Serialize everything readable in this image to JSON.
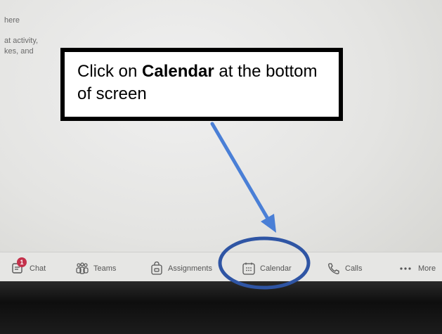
{
  "background_text": [
    "here",
    "at activity,",
    "kes, and"
  ],
  "callout": {
    "prefix": "Click on ",
    "bold": "Calendar",
    "suffix": " at the bottom of screen"
  },
  "taskbar": {
    "items": [
      {
        "label": "Chat",
        "icon": "chat-icon",
        "badge": "1"
      },
      {
        "label": "Teams",
        "icon": "teams-icon"
      },
      {
        "label": "Assignments",
        "icon": "assignments-icon"
      },
      {
        "label": "Calendar",
        "icon": "calendar-icon"
      },
      {
        "label": "Calls",
        "icon": "calls-icon"
      },
      {
        "label": "More",
        "icon": "more-icon"
      }
    ]
  },
  "colors": {
    "arrow": "#4a7fd6",
    "highlight_ellipse": "#2f55a4",
    "badge": "#c4314b"
  }
}
